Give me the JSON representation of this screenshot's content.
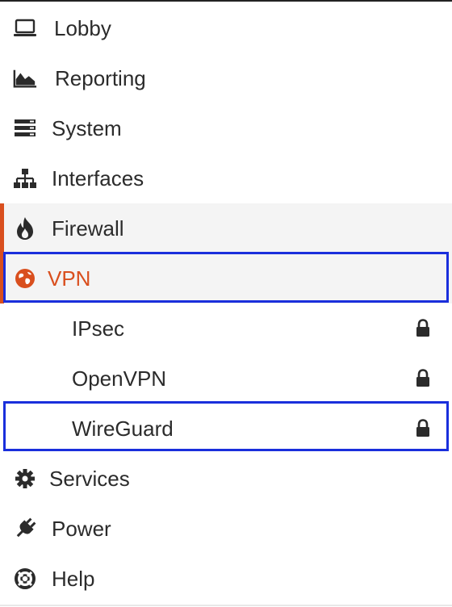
{
  "menu": {
    "items": [
      {
        "label": "Lobby",
        "icon": "laptop-icon"
      },
      {
        "label": "Reporting",
        "icon": "area-chart-icon"
      },
      {
        "label": "System",
        "icon": "server-icon"
      },
      {
        "label": "Interfaces",
        "icon": "sitemap-icon"
      },
      {
        "label": "Firewall",
        "icon": "fire-icon"
      },
      {
        "label": "VPN",
        "icon": "globe-icon"
      },
      {
        "label": "Services",
        "icon": "gear-icon"
      },
      {
        "label": "Power",
        "icon": "plug-icon"
      },
      {
        "label": "Help",
        "icon": "life-ring-icon"
      }
    ],
    "vpn_subitems": [
      {
        "label": "IPsec",
        "icon": "lock-icon"
      },
      {
        "label": "OpenVPN",
        "icon": "lock-icon"
      },
      {
        "label": "WireGuard",
        "icon": "lock-icon"
      }
    ]
  },
  "colors": {
    "accent": "#d94f1e",
    "highlight_box": "#1a2fdc",
    "text": "#2b2b2b",
    "active_background": "#f4f4f4"
  }
}
